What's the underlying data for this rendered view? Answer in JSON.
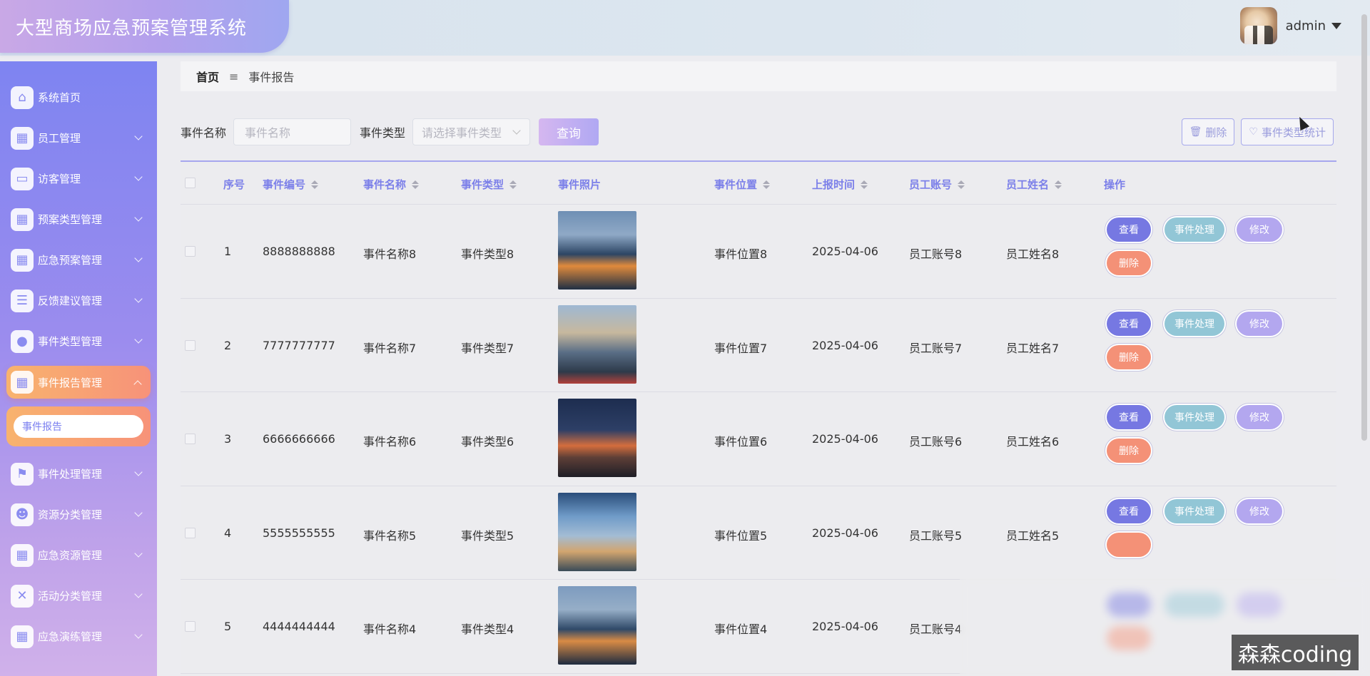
{
  "app": {
    "title": "大型商场应急预案管理系统"
  },
  "user": {
    "name": "admin"
  },
  "breadcrumb": {
    "home": "首页",
    "separator": "≡",
    "current": "事件报告"
  },
  "sidebar": {
    "items": [
      {
        "label": "系统首页",
        "icon": "home-icon"
      },
      {
        "label": "员工管理",
        "icon": "grid-icon"
      },
      {
        "label": "访客管理",
        "icon": "monitor-icon"
      },
      {
        "label": "预案类型管理",
        "icon": "grid-icon"
      },
      {
        "label": "应急预案管理",
        "icon": "grid-icon"
      },
      {
        "label": "反馈建议管理",
        "icon": "list-icon"
      },
      {
        "label": "事件类型管理",
        "icon": "bulb-icon"
      },
      {
        "label": "事件报告管理",
        "icon": "apps-icon"
      },
      {
        "label": "事件处理管理",
        "icon": "flag-icon"
      },
      {
        "label": "资源分类管理",
        "icon": "user-icon"
      },
      {
        "label": "应急资源管理",
        "icon": "grid-icon"
      },
      {
        "label": "活动分类管理",
        "icon": "clipboard-icon"
      },
      {
        "label": "应急演练管理",
        "icon": "grid-icon"
      }
    ],
    "submenu": {
      "label": "事件报告"
    }
  },
  "search": {
    "name_label": "事件名称",
    "name_placeholder": "事件名称",
    "type_label": "事件类型",
    "type_placeholder": "请选择事件类型",
    "query_button": "查询",
    "delete_button": "删除",
    "stats_button": "事件类型统计"
  },
  "table": {
    "headers": [
      "序号",
      "事件编号",
      "事件名称",
      "事件类型",
      "事件照片",
      "事件位置",
      "上报时间",
      "员工账号",
      "员工姓名",
      "操作"
    ],
    "actions": {
      "view": "查看",
      "handle": "事件处理",
      "edit": "修改",
      "delete": "删除"
    },
    "rows": [
      {
        "index": "1",
        "code": "8888888888",
        "name": "事件名称8",
        "type": "事件类型8",
        "location": "事件位置8",
        "time": "2025-04-06",
        "account": "员工账号8",
        "staff": "员工姓名8"
      },
      {
        "index": "2",
        "code": "7777777777",
        "name": "事件名称7",
        "type": "事件类型7",
        "location": "事件位置7",
        "time": "2025-04-06",
        "account": "员工账号7",
        "staff": "员工姓名7"
      },
      {
        "index": "3",
        "code": "6666666666",
        "name": "事件名称6",
        "type": "事件类型6",
        "location": "事件位置6",
        "time": "2025-04-06",
        "account": "员工账号6",
        "staff": "员工姓名6"
      },
      {
        "index": "4",
        "code": "5555555555",
        "name": "事件名称5",
        "type": "事件类型5",
        "location": "事件位置5",
        "time": "2025-04-06",
        "account": "员工账号5",
        "staff": "员工姓名5"
      },
      {
        "index": "5",
        "code": "4444444444",
        "name": "事件名称4",
        "type": "事件类型4",
        "location": "事件位置4",
        "time": "2025-04-06",
        "account": "员工账号4",
        "staff": ""
      }
    ]
  },
  "watermark": "森森coding",
  "colors": {
    "accent": "#7b7fe9",
    "active_menu": "#f8b36e",
    "danger": "#f49177"
  }
}
